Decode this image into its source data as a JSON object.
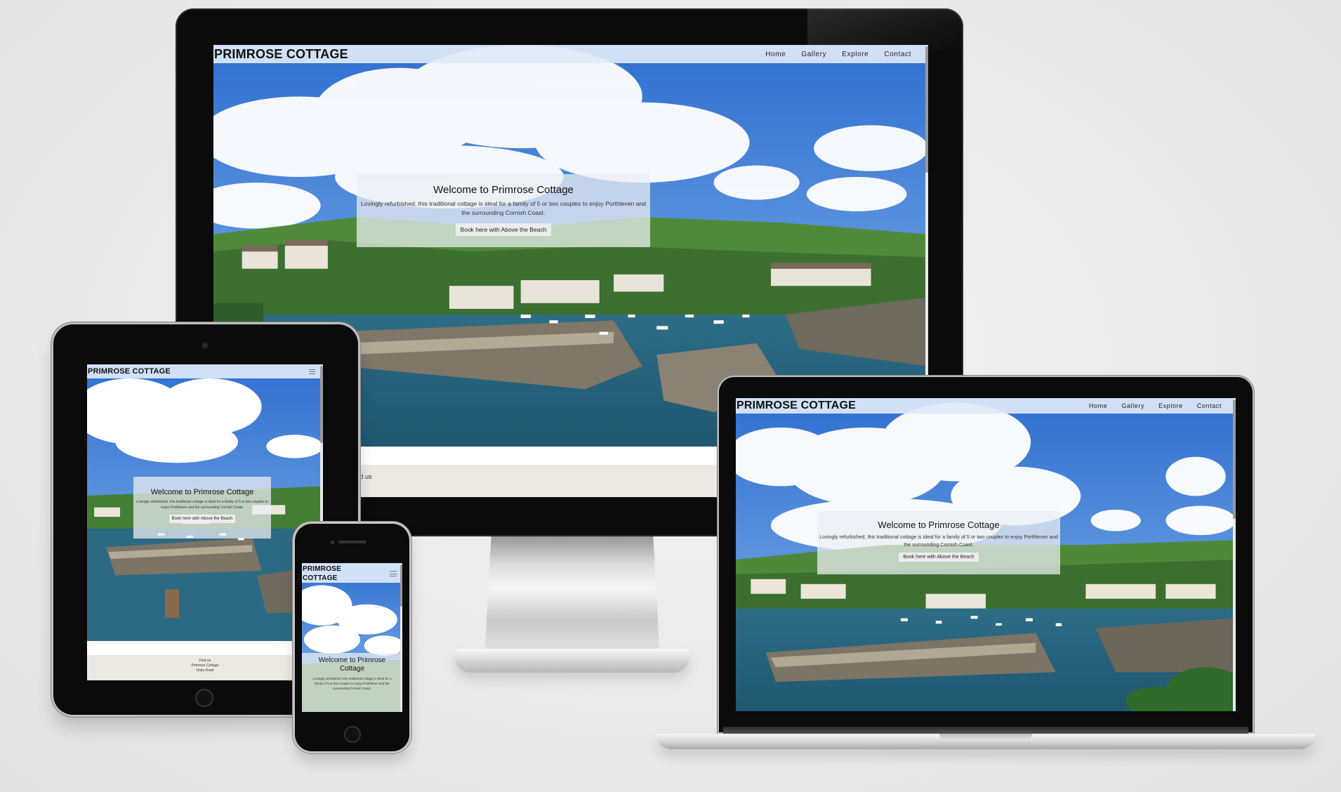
{
  "site": {
    "brand": "PRIMROSE COTTAGE",
    "nav": {
      "home": "Home",
      "gallery": "Gallery",
      "explore": "Explore",
      "contact": "Contact"
    },
    "hero": {
      "title": "Welcome to Primrose Cottage",
      "text": "Lovingly refurbished, this traditional cottage is ideal for a family of 5 or two couples to enjoy Porthleven and the surrounding Cornish Coast.",
      "button": "Book here with Above the Beach"
    },
    "footer": {
      "heading": "Find us",
      "line1": "Primrose Cottage",
      "line2": "Unity Road"
    }
  },
  "devices": {
    "desktop": "monitor",
    "tablet": "tablet",
    "phone": "phone",
    "laptop": "laptop"
  },
  "colors": {
    "navbar": "#dee8f8",
    "hero_panel": "#ebeef2",
    "footer": "#ece9e4",
    "sky": "#3c7fd9",
    "sea": "#2f6f8f",
    "bezel": "#0b0b0b"
  },
  "icons": {
    "menu": "hamburger-menu-icon"
  }
}
